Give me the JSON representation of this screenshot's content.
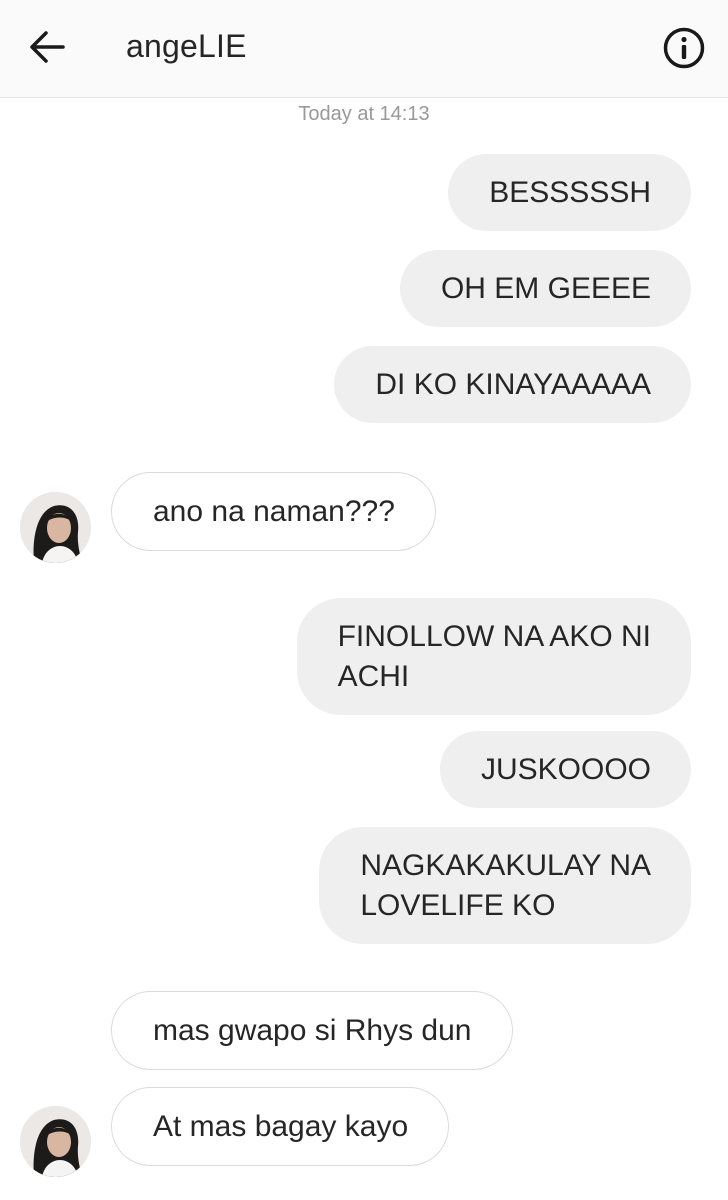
{
  "header": {
    "title": "angeLIE",
    "back_icon": "arrow-left-icon",
    "info_icon": "info-circle-icon"
  },
  "thread": {
    "timestamp": "Today at 14:13",
    "messages": [
      {
        "from": "me",
        "text": "BESSSSSH"
      },
      {
        "from": "me",
        "text": "OH EM GEEEE"
      },
      {
        "from": "me",
        "text": "DI KO KINAYAAAAA"
      },
      {
        "from": "them",
        "text": "ano na naman???"
      },
      {
        "from": "me",
        "text": "FINOLLOW NA AKO NI\nACHI"
      },
      {
        "from": "me",
        "text": "JUSKOOOO"
      },
      {
        "from": "me",
        "text": "NAGKAKAKULAY NA\nLOVELIFE KO"
      },
      {
        "from": "them",
        "text": "mas gwapo si Rhys dun"
      },
      {
        "from": "them",
        "text": "At mas bagay kayo"
      }
    ]
  },
  "colors": {
    "sent_bubble": "#efefef",
    "received_bubble_border": "#dbdbdb",
    "header_bg": "#fafafa",
    "timestamp_text": "#999999"
  }
}
